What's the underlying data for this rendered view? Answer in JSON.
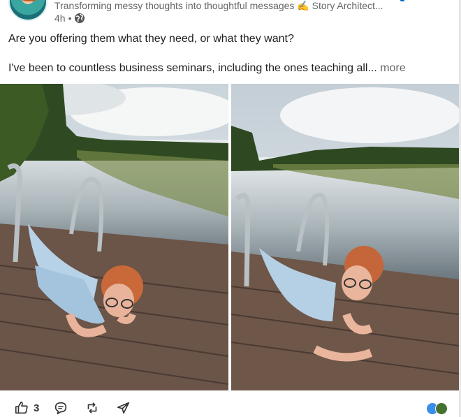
{
  "post": {
    "author_tagline": "Transforming messy thoughts into thoughtful messages ✍ Story Architect...",
    "time_ago": "4h",
    "visibility_separator": "•",
    "visibility_icon": "globe-icon",
    "text_line1": "Are you offering them what they need, or what they want?",
    "text_line2": "I've been to countless business seminars, including the ones teaching all...",
    "more_label": "more"
  },
  "actions": {
    "like_count": "3",
    "like_icon": "thumbs-up-icon",
    "comment_icon": "comment-icon",
    "repost_icon": "repost-icon",
    "send_icon": "send-icon"
  },
  "reactions": [
    "like",
    "celebrate"
  ],
  "colors": {
    "accent": "#0a66c2",
    "text": "#1f1f1f",
    "muted": "#666666",
    "like_badge": "#378fe9",
    "celebrate_badge": "#44712e"
  }
}
